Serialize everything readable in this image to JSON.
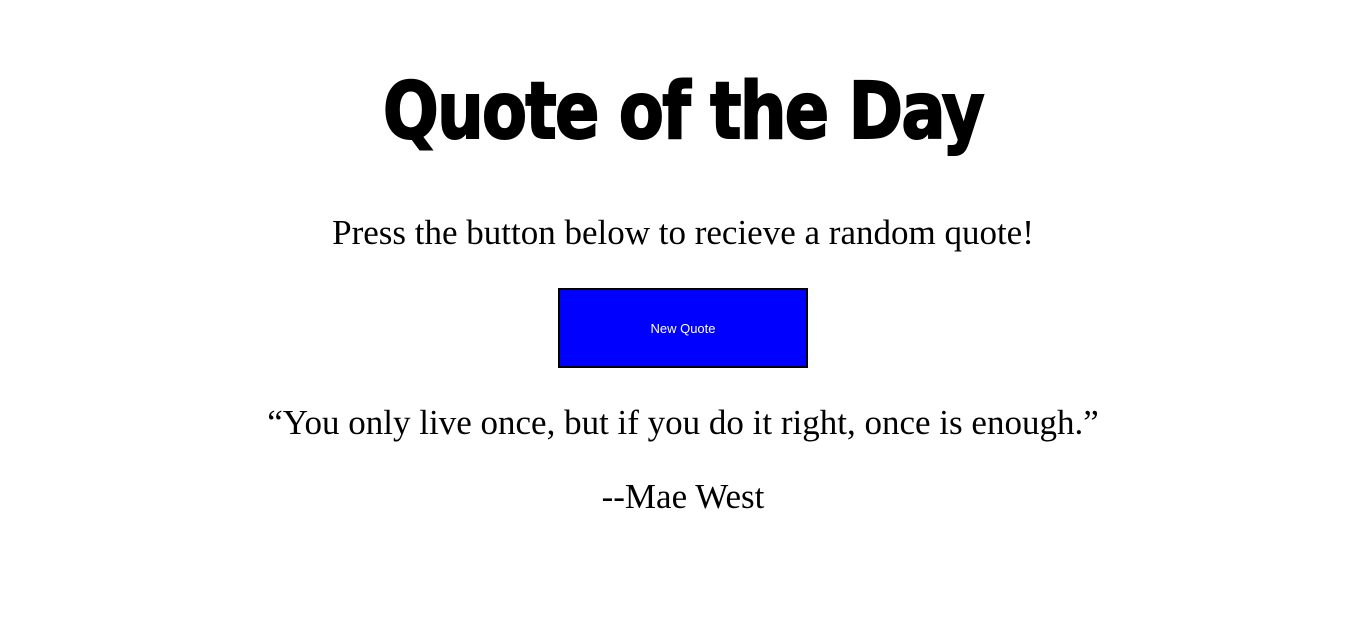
{
  "page": {
    "title": "Quote of the Day",
    "instructions": "Press the button below to recieve a random quote!",
    "button": {
      "label": "New Quote",
      "background_color": "#0000ff",
      "text_color": "#ffffff"
    },
    "quote": {
      "text": "“You only live once, but if you do it right, once is enough.”",
      "author": "--Mae West"
    }
  }
}
